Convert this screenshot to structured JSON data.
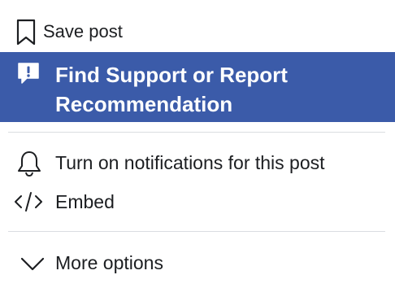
{
  "menu": {
    "items": [
      {
        "label": "Save post",
        "icon": "bookmark-icon"
      },
      {
        "label": "Find Support or Report Recommendation",
        "icon": "report-flag-icon",
        "highlighted": true
      },
      {
        "label": "Turn on notifications for this post",
        "icon": "bell-icon"
      },
      {
        "label": "Embed",
        "icon": "code-icon"
      },
      {
        "label": "More options",
        "icon": "chevron-down-icon"
      }
    ]
  },
  "colors": {
    "highlight_background": "#3b5ba9",
    "highlight_text": "#ffffff",
    "text": "#1c1e21",
    "divider": "#dadde1"
  }
}
